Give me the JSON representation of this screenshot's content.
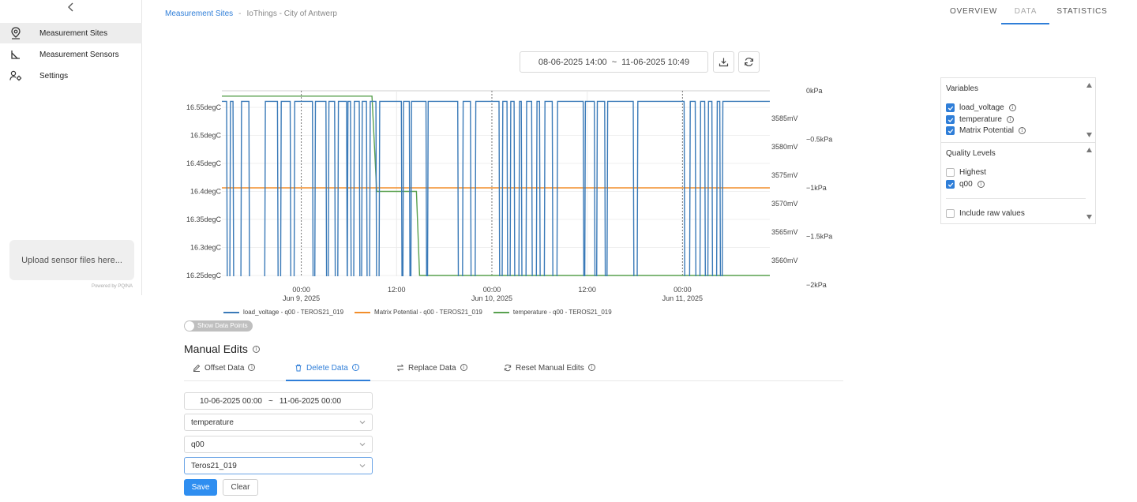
{
  "sidebar": {
    "items": [
      {
        "label": "Measurement Sites",
        "icon": "location-pin-icon",
        "active": true
      },
      {
        "label": "Measurement Sensors",
        "icon": "sensor-angle-icon",
        "active": false
      },
      {
        "label": "Settings",
        "icon": "user-settings-icon",
        "active": false
      }
    ],
    "upload_label": "Upload sensor files here...",
    "powered_by": "Powered by PQINA"
  },
  "breadcrumb": {
    "link": "Measurement Sites",
    "separator": "-",
    "current": "IoThings - City of Antwerp"
  },
  "top_tabs": [
    {
      "label": "OVERVIEW",
      "active": false
    },
    {
      "label": "DATA",
      "active": true
    },
    {
      "label": "STATISTICS",
      "active": false
    }
  ],
  "date_range": {
    "start": "08-06-2025 14:00",
    "separator": "~",
    "end": "11-06-2025 10:49"
  },
  "chart_data": {
    "type": "line",
    "x_ticks": [
      {
        "label": "00:00",
        "sub": "Jun 9, 2025"
      },
      {
        "label": "12:00",
        "sub": ""
      },
      {
        "label": "00:00",
        "sub": "Jun 10, 2025"
      },
      {
        "label": "12:00",
        "sub": ""
      },
      {
        "label": "00:00",
        "sub": "Jun 11, 2025"
      }
    ],
    "y_left_ticks": [
      "16.55degC",
      "16.5degC",
      "16.45degC",
      "16.4degC",
      "16.35degC",
      "16.3degC",
      "16.25degC"
    ],
    "y_mid_ticks": [
      "3585mV",
      "3580mV",
      "3575mV",
      "3570mV",
      "3565mV",
      "3560mV"
    ],
    "y_right_ticks": [
      "0kPa",
      "−0.5kPa",
      "−1kPa",
      "−1.5kPa",
      "−2kPa"
    ],
    "x_range_hours": [
      -10,
      59
    ],
    "series": [
      {
        "name": "load_voltage - q00 - TEROS21_019",
        "color": "#3a7ab8",
        "axis": "mV",
        "low": 3557,
        "high": 3588,
        "toggle_hours": [
          -10,
          -9.4,
          -9.0,
          -8.6,
          -7.6,
          -6.6,
          -4.6,
          -3.0,
          -2.6,
          -1.4,
          -0.9,
          1.4,
          1.7,
          3.1,
          3.4,
          4.2,
          4.6,
          5.7,
          5.8,
          6.2,
          6.6,
          7.3,
          7.6,
          8.2,
          8.6,
          9.4,
          9.8,
          12.6,
          12.8,
          13.6,
          13.8,
          15.7,
          15.9,
          19.7,
          20.3,
          21.3,
          21.9,
          24.9,
          25.3,
          25.9,
          26.3,
          26.8,
          27.4,
          27.7,
          28.3,
          29.0,
          29.6,
          30.0,
          30.6,
          31.6,
          32.2,
          35.5,
          35.7,
          36.9,
          37.2,
          38.2,
          38.5,
          41.8,
          42.3,
          48.2,
          48.9,
          49.6,
          50.2,
          50.8,
          51.2,
          51.7,
          52.3,
          52.7,
          53.0
        ]
      },
      {
        "name": "Matrix Potential - q00 - TEROS21_019",
        "color": "#f28e2b",
        "axis": "kPa",
        "constant": -1
      },
      {
        "name": "temperature - q00 - TEROS21_019",
        "color": "#59a14f",
        "axis": "degC",
        "points": [
          [
            -10,
            16.57
          ],
          [
            8.9,
            16.57
          ],
          [
            9.5,
            16.4
          ],
          [
            14.5,
            16.4
          ],
          [
            14.9,
            16.25
          ],
          [
            59,
            16.25
          ]
        ]
      }
    ]
  },
  "toggle": {
    "label": "Show Data Points",
    "on": false
  },
  "manual_edits": {
    "title": "Manual Edits",
    "tabs": [
      {
        "label": "Offset Data",
        "icon": "pencil-icon",
        "active": false
      },
      {
        "label": "Delete Data",
        "icon": "trash-icon",
        "active": true
      },
      {
        "label": "Replace Data",
        "icon": "swap-icon",
        "active": false
      },
      {
        "label": "Reset Manual Edits",
        "icon": "reset-icon",
        "active": false
      }
    ],
    "range": {
      "start": "10-06-2025 00:00",
      "separator": "~",
      "end": "11-06-2025 00:00"
    },
    "variable": "temperature",
    "quality": "q00",
    "sensor": "Teros21_019",
    "save_label": "Save",
    "clear_label": "Clear"
  },
  "variables_panel": {
    "title": "Variables",
    "items": [
      {
        "label": "load_voltage",
        "checked": true
      },
      {
        "label": "temperature",
        "checked": true
      },
      {
        "label": "Matrix Potential",
        "checked": true
      }
    ]
  },
  "quality_panel": {
    "title": "Quality Levels",
    "items": [
      {
        "label": "Highest",
        "checked": false
      },
      {
        "label": "q00",
        "checked": true
      }
    ],
    "raw_label": "Include raw values",
    "raw_checked": false
  }
}
